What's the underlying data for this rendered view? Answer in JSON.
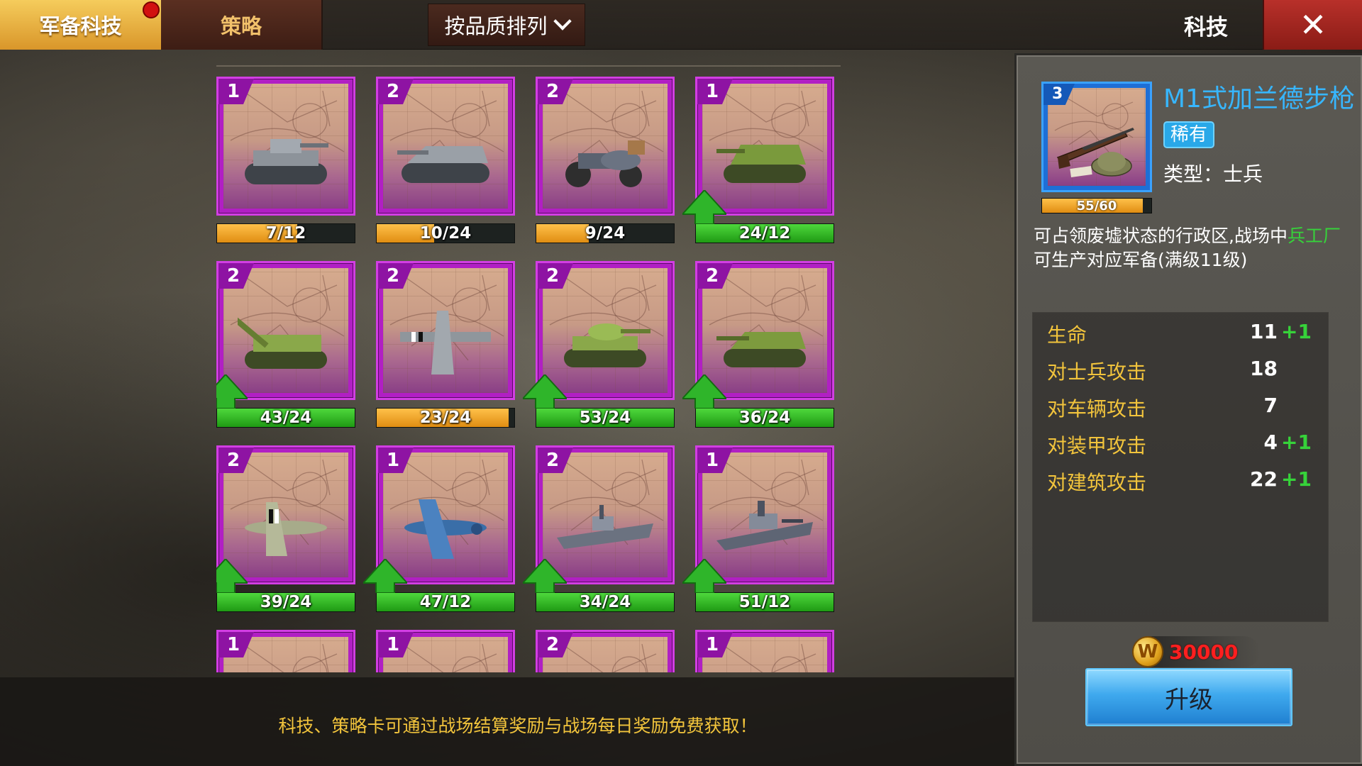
{
  "tabs": [
    {
      "label": "军备科技",
      "active": true
    },
    {
      "label": "策略",
      "active": false
    }
  ],
  "sort": {
    "label": "按品质排列"
  },
  "panel_title": "科技",
  "close_label": "✕",
  "cards": [
    {
      "level": "1",
      "progress": "7/12",
      "status": "orange",
      "progress_ratio": 0.58,
      "can_upgrade": false,
      "icon": "panzer-tank-icon"
    },
    {
      "level": "2",
      "progress": "10/24",
      "status": "orange",
      "progress_ratio": 0.42,
      "can_upgrade": false,
      "icon": "assault-gun-icon"
    },
    {
      "level": "2",
      "progress": "9/24",
      "status": "orange",
      "progress_ratio": 0.38,
      "can_upgrade": false,
      "icon": "sidecar-motorcycle-icon"
    },
    {
      "level": "1",
      "progress": "24/12",
      "status": "green",
      "progress_ratio": 1.0,
      "can_upgrade": true,
      "icon": "tank-destroyer-icon"
    },
    {
      "level": "2",
      "progress": "43/24",
      "status": "green",
      "progress_ratio": 1.0,
      "can_upgrade": true,
      "icon": "self-propelled-artillery-icon"
    },
    {
      "level": "2",
      "progress": "23/24",
      "status": "orange",
      "progress_ratio": 0.96,
      "can_upgrade": false,
      "icon": "bomber-plane-icon"
    },
    {
      "level": "2",
      "progress": "53/24",
      "status": "green",
      "progress_ratio": 1.0,
      "can_upgrade": true,
      "icon": "medium-tank-icon"
    },
    {
      "level": "2",
      "progress": "36/24",
      "status": "green",
      "progress_ratio": 1.0,
      "can_upgrade": true,
      "icon": "heavy-tank-destroyer-icon"
    },
    {
      "level": "2",
      "progress": "39/24",
      "status": "green",
      "progress_ratio": 1.0,
      "can_upgrade": true,
      "icon": "spitfire-fighter-icon"
    },
    {
      "level": "1",
      "progress": "47/12",
      "status": "green",
      "progress_ratio": 1.0,
      "can_upgrade": true,
      "icon": "blue-fighter-plane-icon"
    },
    {
      "level": "2",
      "progress": "34/24",
      "status": "green",
      "progress_ratio": 1.0,
      "can_upgrade": true,
      "icon": "destroyer-ship-icon"
    },
    {
      "level": "1",
      "progress": "51/12",
      "status": "green",
      "progress_ratio": 1.0,
      "can_upgrade": true,
      "icon": "battleship-icon"
    },
    {
      "level": "1",
      "progress": "",
      "status": "none",
      "progress_ratio": 0,
      "can_upgrade": false,
      "icon": ""
    },
    {
      "level": "1",
      "progress": "",
      "status": "none",
      "progress_ratio": 0,
      "can_upgrade": false,
      "icon": ""
    },
    {
      "level": "2",
      "progress": "",
      "status": "none",
      "progress_ratio": 0,
      "can_upgrade": false,
      "icon": ""
    },
    {
      "level": "1",
      "progress": "",
      "status": "none",
      "progress_ratio": 0,
      "can_upgrade": false,
      "icon": ""
    }
  ],
  "detail": {
    "level": "3",
    "name": "M1式加兰德步枪",
    "rarity": "稀有",
    "type": "类型：士兵",
    "progress": "55/60",
    "progress_ratio": 0.92,
    "icon": "m1-garand-rifle-icon",
    "description_part1": "可占领废墟状态的行政区,战场中",
    "description_highlight": "兵工厂",
    "description_part2": "可生产对应军备(满级11级)",
    "stats": [
      {
        "label": "生命",
        "value": "11",
        "bonus": "+1"
      },
      {
        "label": "对士兵攻击",
        "value": "18",
        "bonus": ""
      },
      {
        "label": "对车辆攻击",
        "value": "7",
        "bonus": ""
      },
      {
        "label": "对装甲攻击",
        "value": "4",
        "bonus": "+1"
      },
      {
        "label": "对建筑攻击",
        "value": "22",
        "bonus": "+1"
      }
    ],
    "cost_icon": "W",
    "cost": "30000",
    "upgrade_label": "升级"
  },
  "tip": "科技、策略卡可通过战场结算奖励与战场每日奖励免费获取！",
  "colors": {
    "tab_active": "#e6a83a",
    "card_purple": "#b11fc4",
    "card_blue": "#1e6fd6",
    "progress_orange": "#f3a82a",
    "progress_green": "#34c02a",
    "rarity_blue": "#29a8e8",
    "stat_label": "#f2c43c",
    "bonus_green": "#36d33a",
    "cost_red": "#ff1f1f"
  }
}
